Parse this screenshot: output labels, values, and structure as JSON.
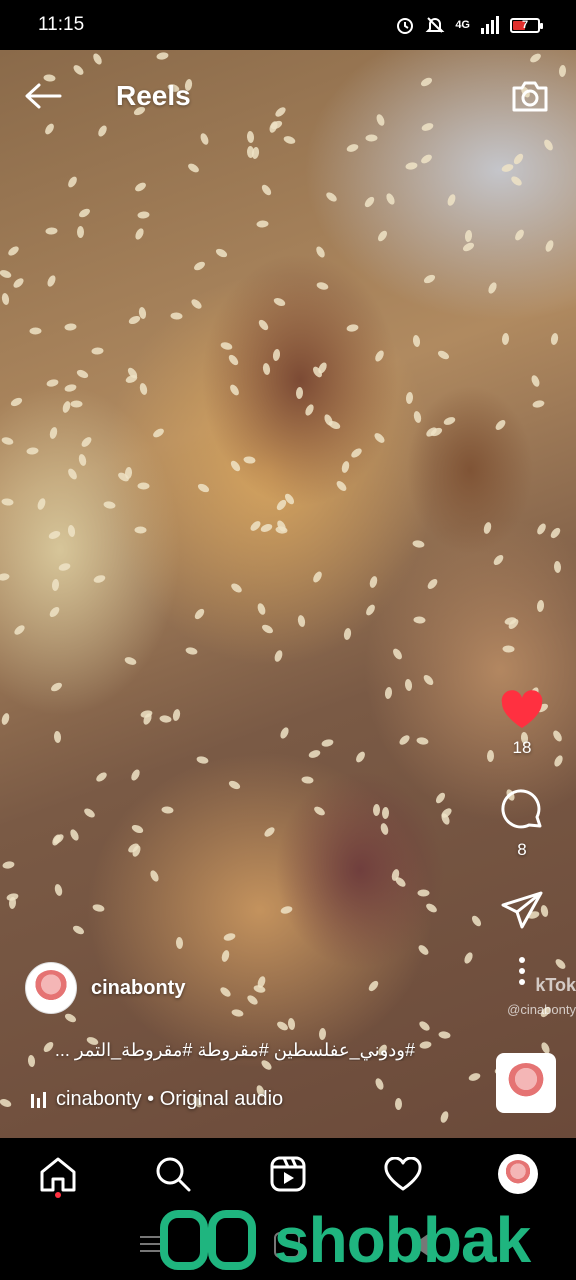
{
  "status_bar": {
    "time": "11:15",
    "network": "4G",
    "battery_level": "7",
    "icons": [
      "alarm-icon",
      "mute-icon",
      "signal-icon",
      "battery-icon"
    ]
  },
  "header": {
    "title": "Reels",
    "icons": [
      "back-arrow-icon",
      "camera-icon"
    ]
  },
  "actions": {
    "like_count": "18",
    "comment_count": "8",
    "like_color": "#ff3040",
    "icons": [
      "heart-icon",
      "comment-icon",
      "share-icon",
      "more-icon"
    ]
  },
  "video": {
    "watermark": "kTok",
    "watermark_handle": "@cinabonty"
  },
  "post": {
    "username": "cinabonty",
    "caption": "#ودوني_عفلسطين #مقروطة #مقروطة_التمر ...",
    "audio": "cinabonty • Original audio"
  },
  "bottom_nav": {
    "items": [
      "home-icon",
      "search-icon",
      "reels-icon",
      "activity-icon",
      "profile-avatar"
    ],
    "active": "home-icon"
  },
  "overlay": {
    "brand": "shobbak",
    "brand_color": "#1fb57f"
  }
}
